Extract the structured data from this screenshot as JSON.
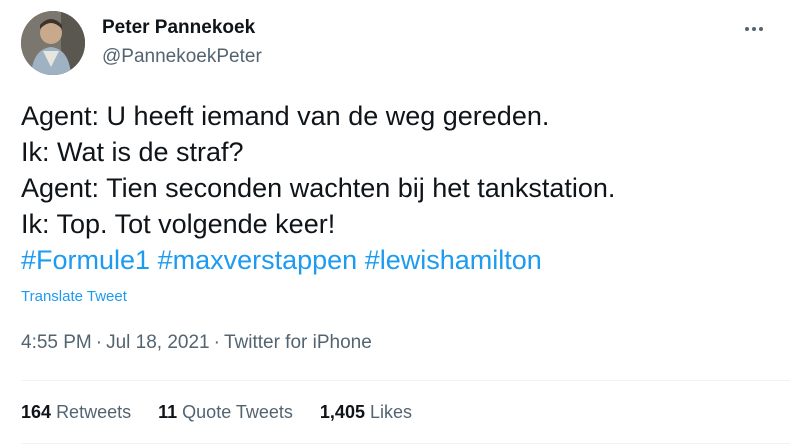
{
  "author": {
    "name": "Peter Pannekoek",
    "handle": "@PannekoekPeter"
  },
  "tweet": {
    "lines": [
      "Agent: U heeft iemand van de weg gereden.",
      "Ik: Wat is de straf?",
      "Agent: Tien seconden wachten bij het tankstation.",
      "Ik: Top. Tot volgende keer!"
    ],
    "hashtags": [
      "#Formule1",
      "#maxverstappen",
      "#lewishamilton"
    ]
  },
  "translate_label": "Translate Tweet",
  "meta": {
    "time": "4:55 PM",
    "date": "Jul 18, 2021",
    "source": "Twitter for iPhone"
  },
  "stats": {
    "retweets_count": "164",
    "retweets_label": "Retweets",
    "quotes_count": "11",
    "quotes_label": "Quote Tweets",
    "likes_count": "1,405",
    "likes_label": "Likes"
  },
  "colors": {
    "link": "#1d9bf0",
    "text": "#0f1419",
    "secondary": "#536471"
  },
  "icons": {
    "more": "more-icon"
  }
}
